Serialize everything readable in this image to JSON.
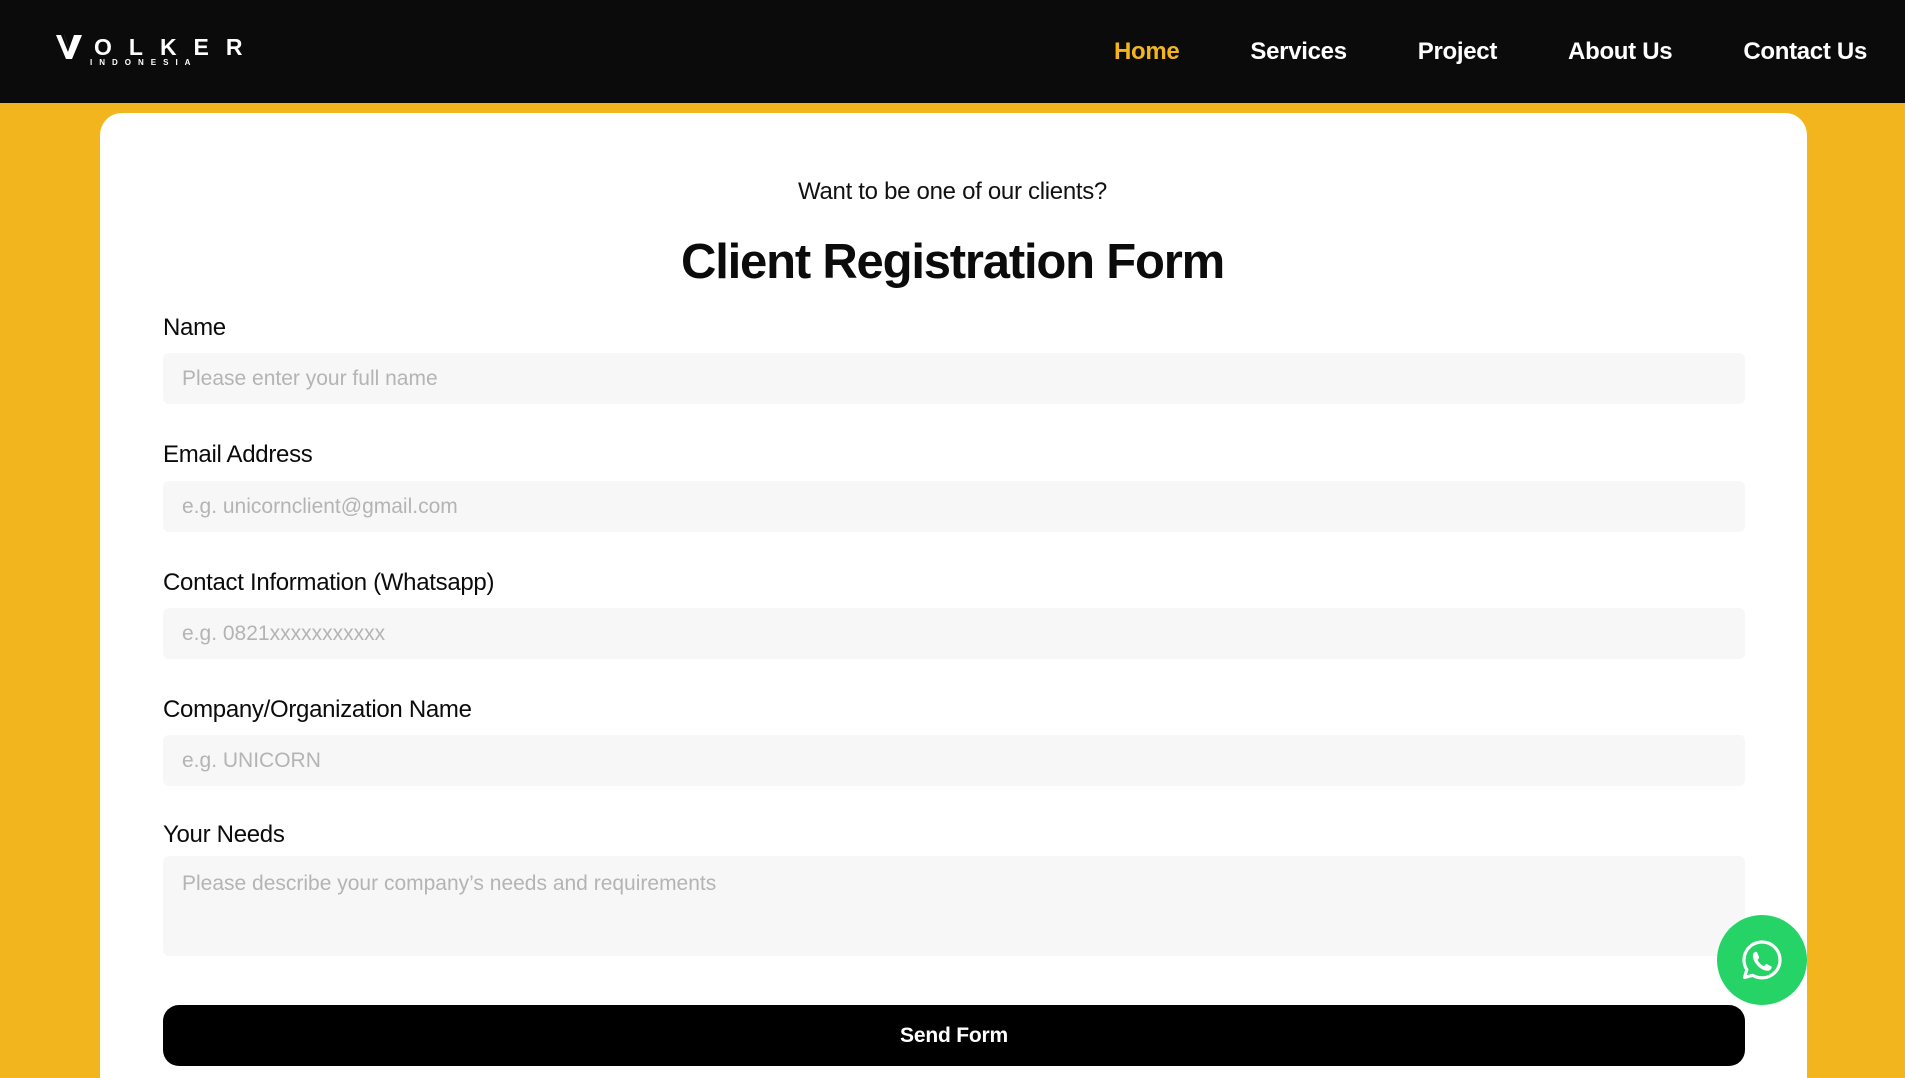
{
  "brand": {
    "name_main": "OLKER",
    "name_sub": "INDONESIA",
    "logo_icon": "volker-v-logo-icon"
  },
  "nav": {
    "items": [
      {
        "label": "Home",
        "active": true
      },
      {
        "label": "Services",
        "active": false
      },
      {
        "label": "Project",
        "active": false
      },
      {
        "label": "About Us",
        "active": false
      },
      {
        "label": "Contact Us",
        "active": false
      }
    ]
  },
  "form": {
    "tagline": "Want to be one of our clients?",
    "title": "Client Registration Form",
    "fields": [
      {
        "label": "Name",
        "placeholder": "Please enter your full name",
        "value": ""
      },
      {
        "label": "Email Address",
        "placeholder": "e.g. unicornclient@gmail.com",
        "value": ""
      },
      {
        "label": "Contact Information (Whatsapp)",
        "placeholder": "e.g. 0821xxxxxxxxxxx",
        "value": ""
      },
      {
        "label": "Company/Organization Name",
        "placeholder": "e.g. UNICORN",
        "value": ""
      },
      {
        "label": "Your Needs",
        "placeholder": "Please describe your company’s needs and requirements",
        "value": ""
      }
    ],
    "submit_label": "Send Form"
  },
  "floating": {
    "whatsapp_icon": "whatsapp-icon"
  },
  "colors": {
    "accent": "#F2B51E",
    "navbar_bg": "#0B0B0C",
    "whatsapp_green": "#25D366",
    "button_bg": "#000000"
  }
}
